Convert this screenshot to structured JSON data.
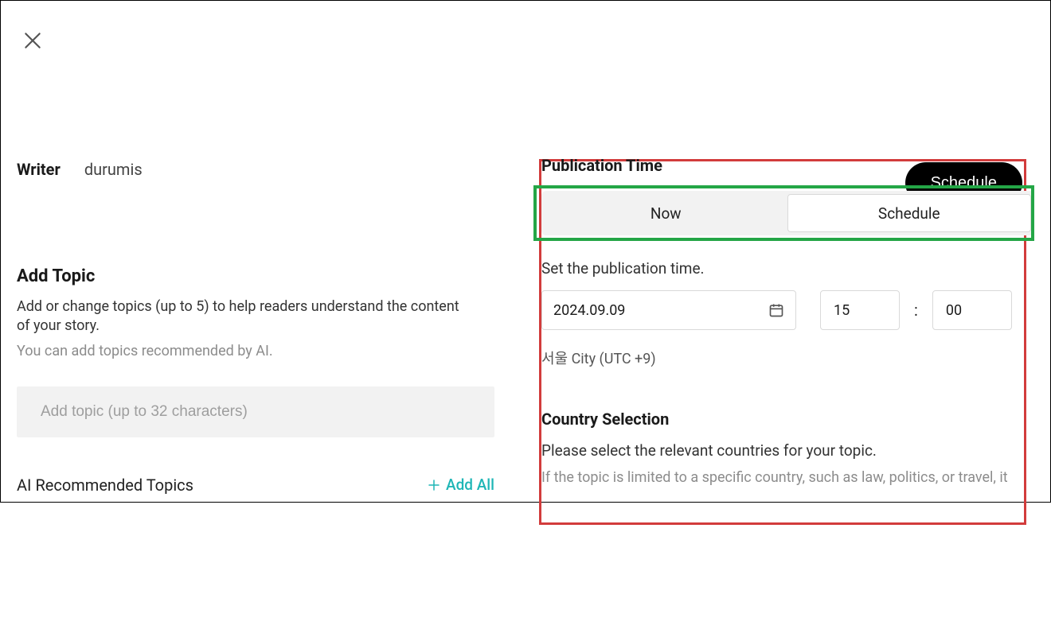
{
  "left": {
    "writer_label": "Writer",
    "writer_name": "durumis",
    "add_topic_title": "Add Topic",
    "add_topic_desc": "Add or change topics (up to 5) to help readers understand the content of your story.",
    "add_topic_sub": "You can add topics recommended by AI.",
    "topic_placeholder": "Add topic (up to 32 characters)",
    "ai_title": "AI Recommended Topics",
    "add_all_label": "Add All"
  },
  "right": {
    "schedule_button": "Schedule",
    "pub_title": "Publication Time",
    "toggle": {
      "now": "Now",
      "schedule": "Schedule",
      "active": "schedule"
    },
    "set_label": "Set the publication time.",
    "date_value": "2024.09.09",
    "hours": "15",
    "minutes": "00",
    "separator": ":",
    "tz": "서울 City (UTC +9)",
    "country_title": "Country Selection",
    "country_desc": "Please select the relevant countries for your topic.",
    "country_sub": "If the topic is limited to a specific country, such as law, politics, or travel, it"
  }
}
